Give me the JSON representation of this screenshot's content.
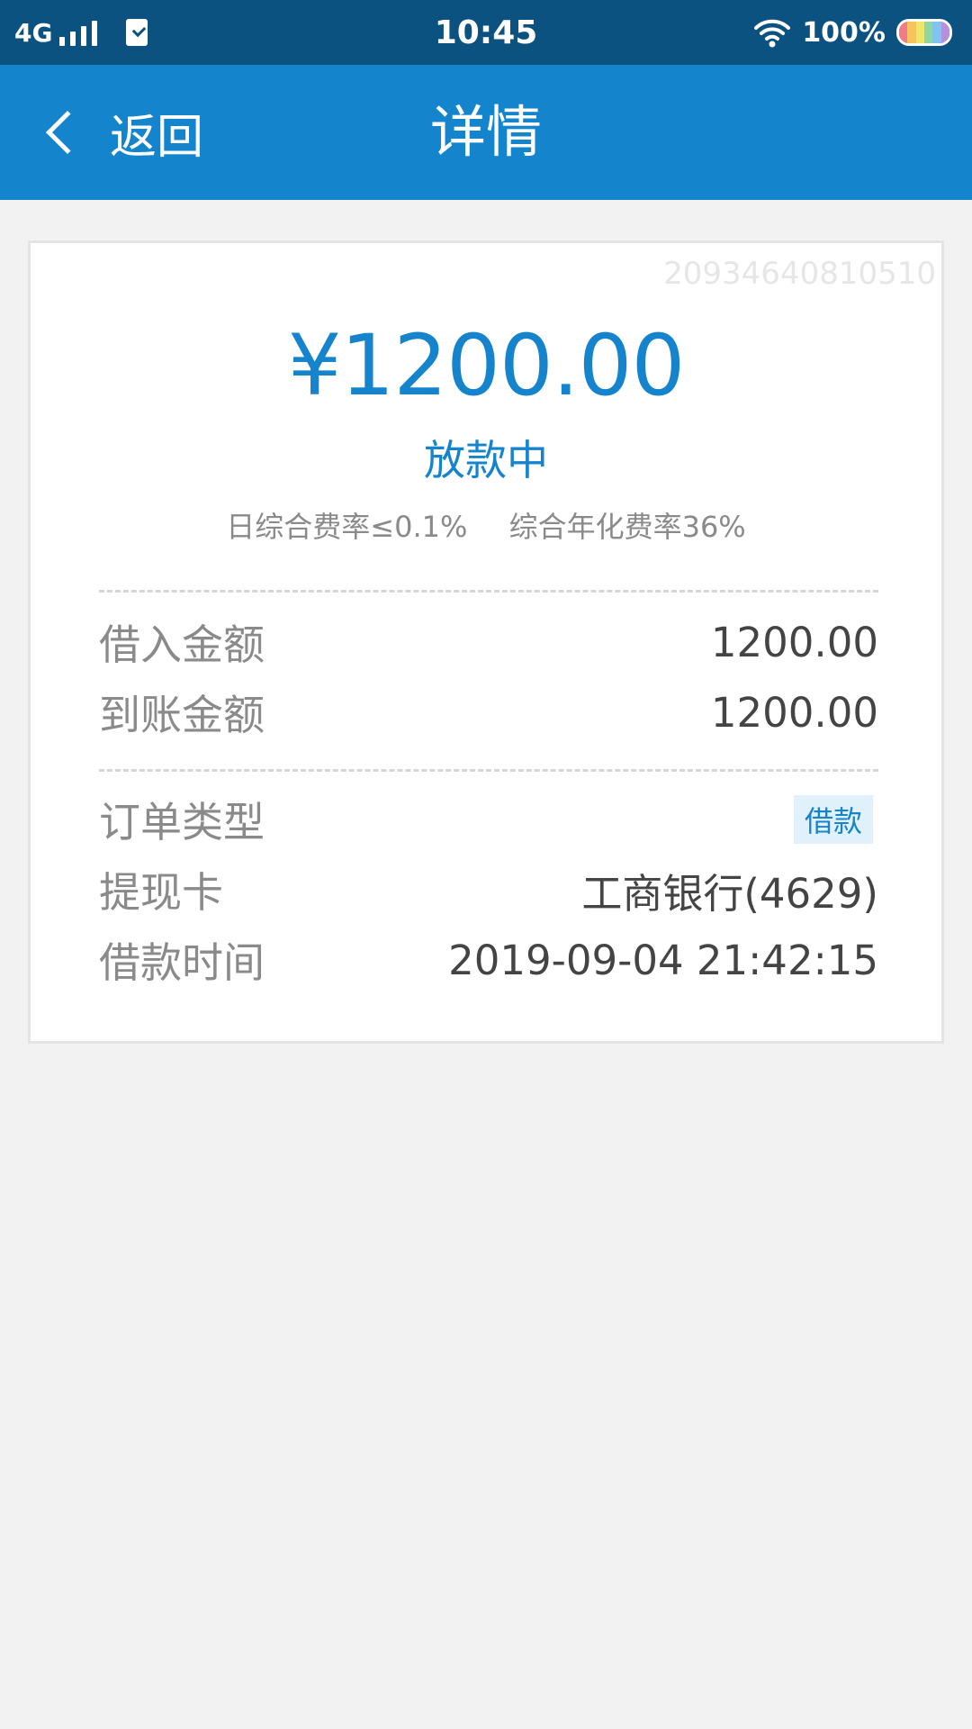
{
  "status_bar": {
    "network": "4G",
    "time": "10:45",
    "battery": "100%"
  },
  "header": {
    "back_label": "返回",
    "title": "详情"
  },
  "card": {
    "order_no": "20934640810510",
    "amount": "¥1200.00",
    "status": "放款中",
    "daily_rate": "日综合费率≤0.1%",
    "annual_rate": "综合年化费率36%",
    "rows": [
      {
        "label": "借入金额",
        "value": "1200.00"
      },
      {
        "label": "到账金额",
        "value": "1200.00"
      },
      {
        "label": "订单类型",
        "value": "借款"
      },
      {
        "label": "提现卡",
        "value": "工商银行(4629)"
      },
      {
        "label": "借款时间",
        "value": "2019-09-04 21:42:15"
      }
    ]
  },
  "colors": {
    "status_bar": "#0c5281",
    "header": "#1484cd",
    "accent": "#1684cd",
    "background": "#f2f2f2"
  },
  "icons": {
    "back": "chevron-left-icon",
    "signal": "signal-icon",
    "sim": "sim-card-icon",
    "wifi": "wifi-icon",
    "battery": "battery-icon"
  }
}
